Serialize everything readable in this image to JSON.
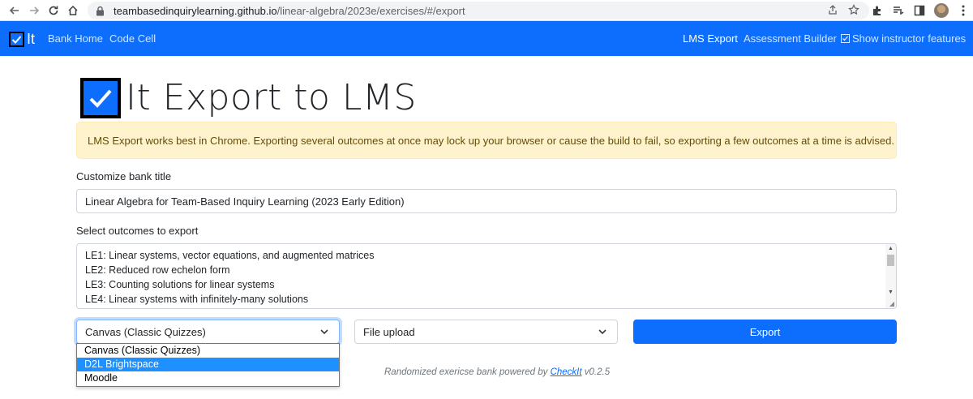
{
  "browser": {
    "url_host": "teambasedinquirylearning.github.io",
    "url_path": "/linear-algebra/2023e/exercises/#/export"
  },
  "navbar": {
    "brand": "It",
    "links": [
      "Bank Home",
      "Code Cell"
    ],
    "right_links": [
      "LMS Export",
      "Assessment Builder"
    ],
    "instructor_toggle": "Show instructor features"
  },
  "page": {
    "title": "It Export to LMS",
    "alert": "LMS Export works best in Chrome. Exporting several outcomes at once may lock up your browser or cause the build to fail, so exporting a few outcomes at a time is advised.",
    "bank_title_label": "Customize bank title",
    "bank_title_value": "Linear Algebra for Team-Based Inquiry Learning (2023 Early Edition)",
    "outcomes_label": "Select outcomes to export",
    "outcomes": [
      "LE1: Linear systems, vector equations, and augmented matrices",
      "LE2: Reduced row echelon form",
      "LE3: Counting solutions for linear systems",
      "LE4: Linear systems with infinitely-many solutions"
    ],
    "lms_select_value": "Canvas (Classic Quizzes)",
    "method_select_value": "File upload",
    "export_button": "Export",
    "lms_options": [
      "Canvas (Classic Quizzes)",
      "D2L Brightspace",
      "Moodle"
    ],
    "highlighted_option": "D2L Brightspace",
    "footer_prefix": "Randomized exericse bank powered by",
    "footer_link": "CheckIt",
    "footer_version": "v0.2.5"
  },
  "colors": {
    "primary": "#0d6efd",
    "alert_bg": "#fff3cd",
    "alert_text": "#664d03"
  }
}
